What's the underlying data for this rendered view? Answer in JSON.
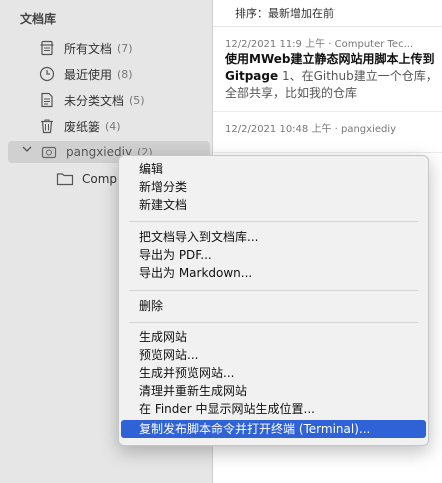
{
  "sidebar": {
    "header": "文档库",
    "items": [
      {
        "label": "所有文档",
        "count": "(7)",
        "icon": "all-docs-icon"
      },
      {
        "label": "最近使用",
        "count": "(8)",
        "icon": "clock-icon"
      },
      {
        "label": "未分类文档",
        "count": "(5)",
        "icon": "uncategorized-icon"
      },
      {
        "label": "废纸篓",
        "count": "(4)",
        "icon": "trash-icon"
      }
    ],
    "project": {
      "label": "pangxiediy",
      "count": "(2)"
    },
    "subfolder": {
      "label": "Compu"
    }
  },
  "list": {
    "sort_label": "排序：最新增加在前",
    "notes": [
      {
        "meta": "12/2/2021 11:9 上午 · Computer Tec...",
        "title": "使用MWeb建立静态网站用脚本上传到Gitpage",
        "excerpt": "1、在Github建立一个仓库，全部共享，比如我的仓库"
      },
      {
        "meta": "12/2/2021 10:48 上午 · pangxiediy"
      }
    ]
  },
  "context_menu": {
    "groups": [
      [
        "编辑",
        "新增分类",
        "新建文档"
      ],
      [
        "把文档导入到文档库...",
        "导出为 PDF...",
        "导出为 Markdown..."
      ],
      [
        "删除"
      ],
      [
        "生成网站",
        "预览网站...",
        "生成并预览网站...",
        "清理并重新生成网站",
        "在 Finder 中显示网站生成位置...",
        "复制发布脚本命令并打开终端 (Terminal)..."
      ]
    ],
    "highlighted": "复制发布脚本命令并打开终端 (Terminal)..."
  }
}
